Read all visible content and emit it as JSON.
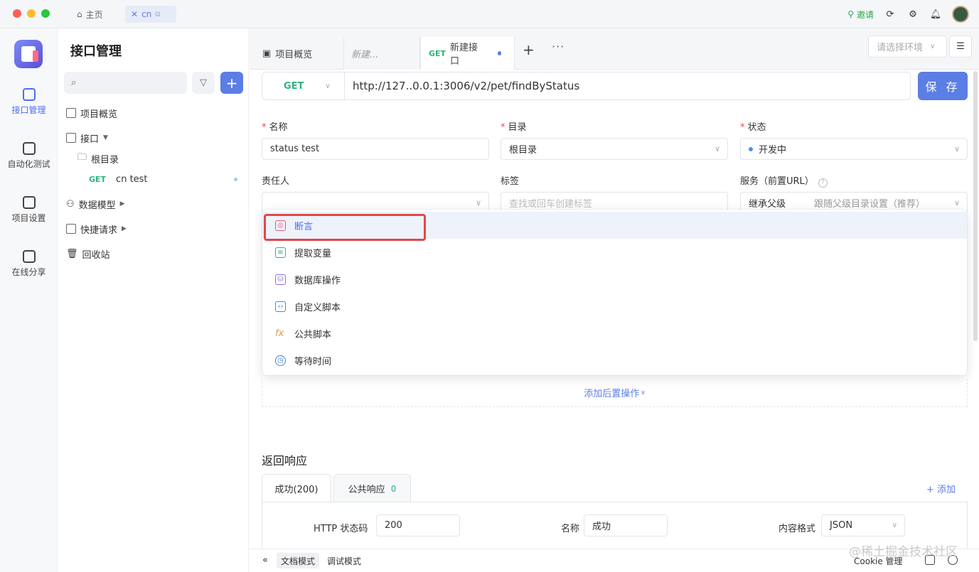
{
  "titlebar": {
    "home_tab": "主页",
    "project_tab": "cn",
    "invite": "邀请"
  },
  "rail": {
    "items": [
      {
        "label": "接口管理",
        "icon": "api-icon"
      },
      {
        "label": "自动化测试",
        "icon": "automation-icon"
      },
      {
        "label": "项目设置",
        "icon": "settings-icon"
      },
      {
        "label": "在线分享",
        "icon": "share-icon"
      }
    ]
  },
  "tree": {
    "title": "接口管理",
    "overview": "项目概览",
    "api": "接口",
    "root_dir": "根目录",
    "api_item_method": "GET",
    "api_item_name": "cn test",
    "data_models": "数据模型",
    "quick_requests": "快捷请求",
    "recycle_bin": "回收站"
  },
  "tabs": {
    "overview": "项目概览",
    "new_placeholder": "新建...",
    "active_method": "GET",
    "active_label": "新建接口",
    "env_placeholder": "请选择环境"
  },
  "request": {
    "method": "GET",
    "url": "http://127..0.0.1:3006/v2/pet/findByStatus",
    "save_label": "保 存"
  },
  "form": {
    "name_label": "名称",
    "name_value": "status test",
    "dir_label": "目录",
    "dir_value": "根目录",
    "status_label": "状态",
    "status_value": "开发中",
    "owner_label": "责任人",
    "tags_label": "标签",
    "tags_placeholder": "查找或回车创建标签",
    "service_label": "服务（前置URL）",
    "service_value": "继承父级",
    "service_hint": "跟随父级目录设置（推荐）"
  },
  "dropdown": {
    "items": [
      {
        "label": "断言",
        "icon": "assertion-icon"
      },
      {
        "label": "提取变量",
        "icon": "extract-variable-icon"
      },
      {
        "label": "数据库操作",
        "icon": "database-icon"
      },
      {
        "label": "自定义脚本",
        "icon": "script-icon"
      },
      {
        "label": "公共脚本",
        "icon": "fx-icon"
      },
      {
        "label": "等待时间",
        "icon": "clock-icon"
      }
    ]
  },
  "post_ops": "添加后置操作",
  "response": {
    "title": "返回响应",
    "tab_success": "成功(200)",
    "tab_common": "公共响应",
    "tab_common_count": "0",
    "add_label": "+ 添加",
    "http_code_label": "HTTP 状态码",
    "http_code_value": "200",
    "name_label": "名称",
    "name_value": "成功",
    "format_label": "内容格式",
    "format_value": "JSON"
  },
  "bottombar": {
    "doc_mode": "文档模式",
    "debug_mode": "调试模式",
    "cookie": "Cookie 管理"
  },
  "watermark": "@稀土掘金技术社区",
  "colors": {
    "accent": "#5b7ee5",
    "get_method": "#2db47d",
    "highlight": "#e04848"
  }
}
